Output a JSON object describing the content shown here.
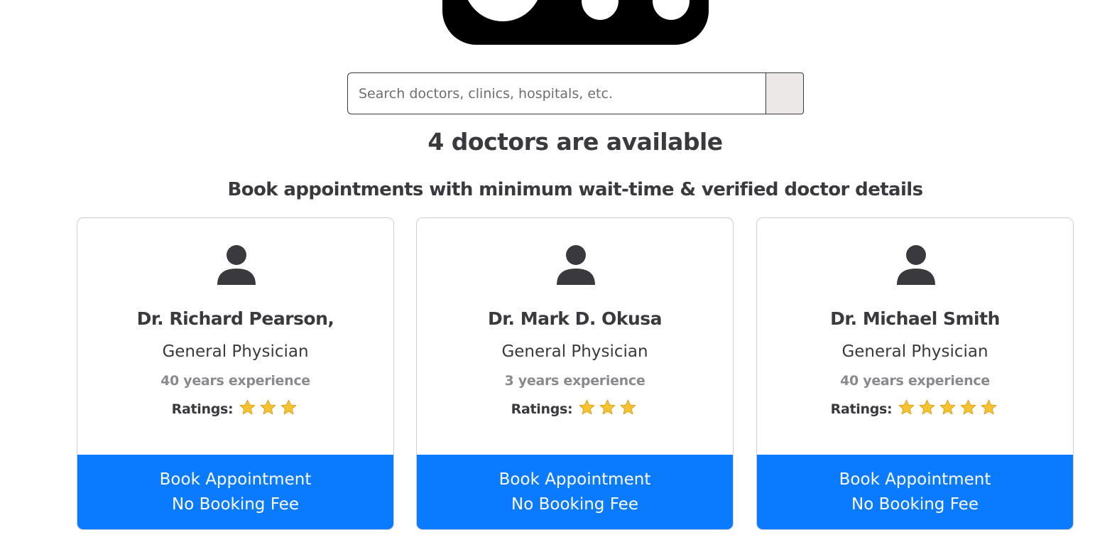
{
  "search": {
    "placeholder": "Search doctors, clinics, hospitals, etc."
  },
  "summary": {
    "count_text": "4 doctors are available",
    "subtitle": "Book appointments with minimum wait-time & verified doctor details"
  },
  "doctors": [
    {
      "name": "Dr. Richard Pearson,",
      "specialty": "General Physician",
      "experience": "40 years experience",
      "ratings_label": "Ratings:",
      "rating": 3,
      "button_line1": "Book Appointment",
      "button_line2": "No Booking Fee"
    },
    {
      "name": "Dr. Mark D. Okusa",
      "specialty": "General Physician",
      "experience": "3 years experience",
      "ratings_label": "Ratings:",
      "rating": 3,
      "button_line1": "Book Appointment",
      "button_line2": "No Booking Fee"
    },
    {
      "name": "Dr. Michael Smith",
      "specialty": "General Physician",
      "experience": "40 years experience",
      "ratings_label": "Ratings:",
      "rating": 5,
      "button_line1": "Book Appointment",
      "button_line2": "No Booking Fee"
    }
  ],
  "colors": {
    "accent": "#0a7aff",
    "text": "#3a393e",
    "muted": "#8a8a8e",
    "star": "#f5c330"
  },
  "icons": {
    "avatar": "person-icon",
    "rating": "star-icon"
  }
}
